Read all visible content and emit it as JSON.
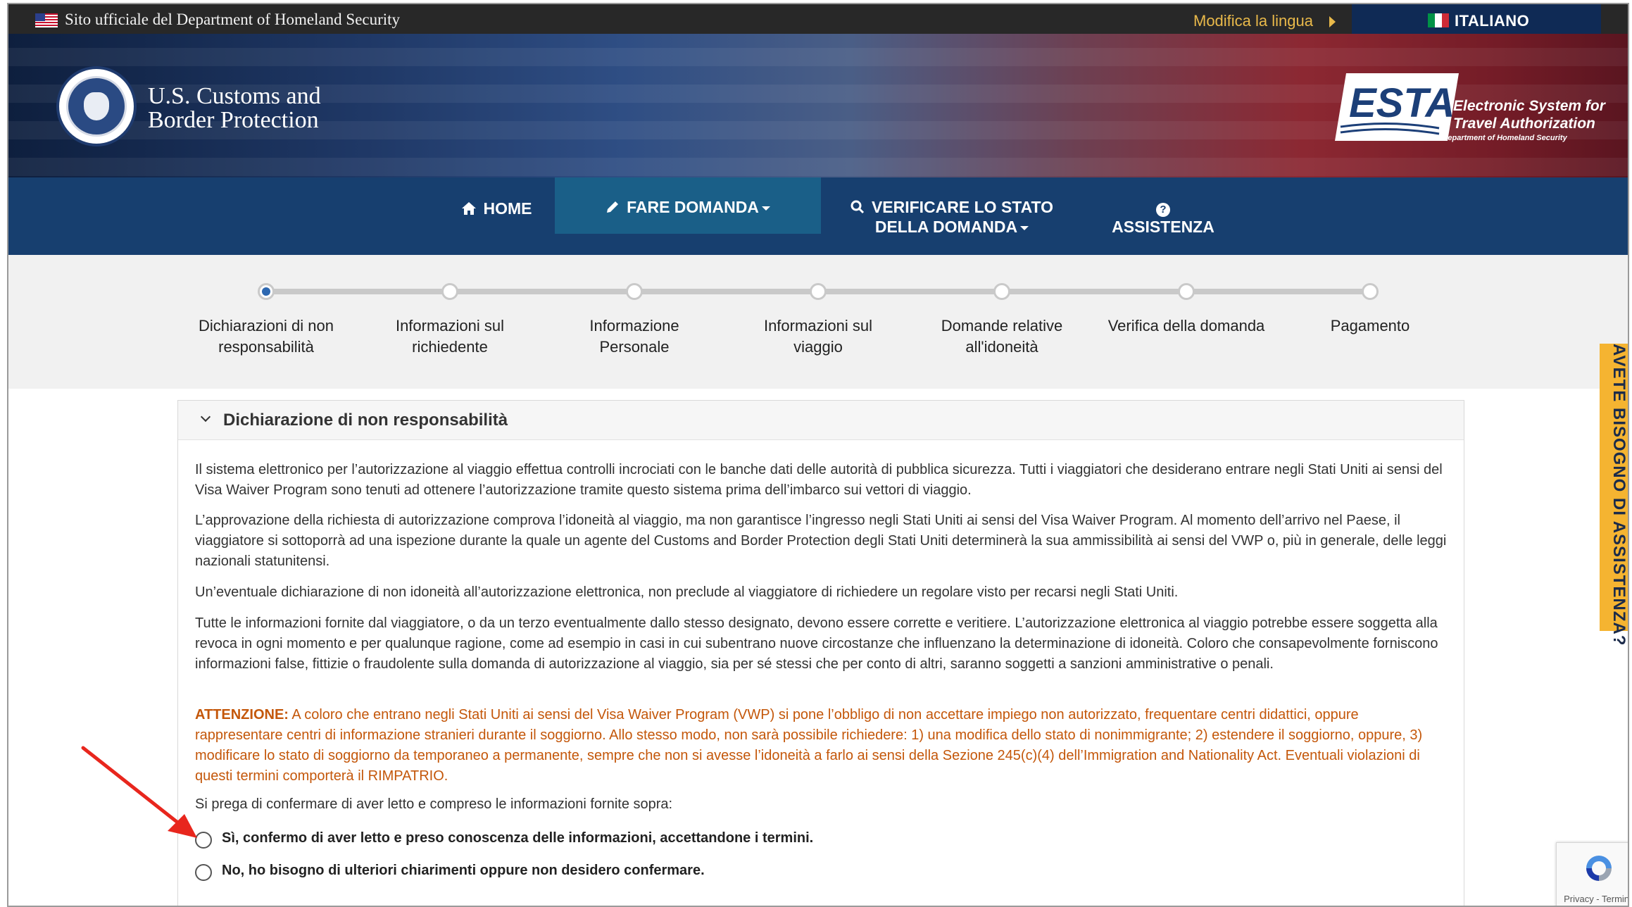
{
  "official_bar": {
    "text": "Sito ufficiale del Department of Homeland Security",
    "change_language": "Modifica la lingua",
    "current_language": "ITALIANO"
  },
  "header": {
    "agency_line1": "U.S. Customs and",
    "agency_line2": "Border Protection",
    "esta_logo": "ESTA",
    "esta_sub1": "Electronic System for",
    "esta_sub2": "Travel Authorization",
    "esta_dept": "U.S. Department of Homeland Security"
  },
  "nav": {
    "home": "HOME",
    "apply": "FARE DOMANDA",
    "check_line1": "VERIFICARE LO STATO",
    "check_line2": "DELLA DOMANDA",
    "help": "ASSISTENZA",
    "help_icon": "?"
  },
  "progress": {
    "steps": [
      {
        "line1": "Dichiarazioni di non",
        "line2": "responsabilità"
      },
      {
        "line1": "Informazioni sul",
        "line2": "richiedente"
      },
      {
        "line1": "Informazione",
        "line2": "Personale"
      },
      {
        "line1": "Informazioni sul",
        "line2": "viaggio"
      },
      {
        "line1": "Domande relative",
        "line2": "all'idoneità"
      },
      {
        "line1": "Verifica della domanda",
        "line2": ""
      },
      {
        "line1": "Pagamento",
        "line2": ""
      }
    ],
    "current_step": 1
  },
  "panel": {
    "title": "Dichiarazione di non responsabilità",
    "p1": "Il sistema elettronico per l’autorizzazione al viaggio effettua controlli incrociati con le banche dati delle autorità di pubblica sicurezza. Tutti i viaggiatori che desiderano entrare negli Stati Uniti ai sensi del Visa Waiver Program sono tenuti ad ottenere l’autorizzazione tramite questo sistema prima dell’imbarco sui vettori di viaggio.",
    "p2": "L’approvazione della richiesta di autorizzazione comprova l’idoneità al viaggio, ma non garantisce l’ingresso negli Stati Uniti ai sensi del Visa Waiver Program. Al momento dell’arrivo nel Paese, il viaggiatore si sottoporrà ad una ispezione durante la quale un agente del Customs and Border Protection degli Stati Uniti determinerà la sua ammissibilità ai sensi del VWP o, più in generale, delle leggi nazionali statunitensi.",
    "p3": "Un’eventuale dichiarazione di non idoneità all’autorizzazione elettronica, non preclude al viaggiatore di richiedere un regolare visto per recarsi negli Stati Uniti.",
    "p4": "Tutte le informazioni fornite dal viaggiatore, o da un terzo eventualmente dallo stesso designato, devono essere corrette e veritiere. L’autorizzazione elettronica al viaggio potrebbe essere soggetta alla revoca in ogni momento e per qualunque ragione, come ad esempio in casi in cui subentrano nuove circostanze che influenzano la determinazione di idoneità. Coloro che consapevolmente forniscono informazioni false, fittizie o fraudolente sulla domanda di autorizzazione al viaggio, sia per sé stessi che per conto di altri, saranno soggetti a sanzioni amministrative o penali.",
    "warn_label": "ATTENZIONE:",
    "warn_text": " A coloro che entrano negli Stati Uniti ai sensi del Visa Waiver Program (VWP) si pone l’obbligo di non accettare impiego non autorizzato, frequentare centri didattici, oppure rappresentare centri di informazione stranieri durante il soggiorno. Allo stesso modo, non sarà possibile richiedere: 1) una modifica dello stato di nonimmigrante; 2) estendere il soggiorno, oppure, 3) modificare lo stato di soggiorno da temporaneo a permanente, sempre che non si avesse l’idoneità a farlo ai sensi della Sezione 245(c)(4) dell’Immigration and Nationality Act. Eventuali violazioni di questi termini comporterà il RIMPATRIO.",
    "confirm_prompt": "Si prega di confermare di aver letto e compreso le informazioni fornite sopra:",
    "option_yes": "Sì, confermo di aver letto e preso conoscenza delle informazioni, accettandone i termini.",
    "option_no": "No, ho bisogno di ulteriori chiarimenti oppure non desidero confermare."
  },
  "side_tab": "AVETE BISOGNO DI ASSISTENZA?",
  "recaptcha": "Privacy - Termini",
  "colors": {
    "nav_bg": "#173f6f",
    "nav_active": "#1a5f88",
    "warning": "#c4570a",
    "side_tab": "#f5b431",
    "step_active": "#2d68b1"
  }
}
